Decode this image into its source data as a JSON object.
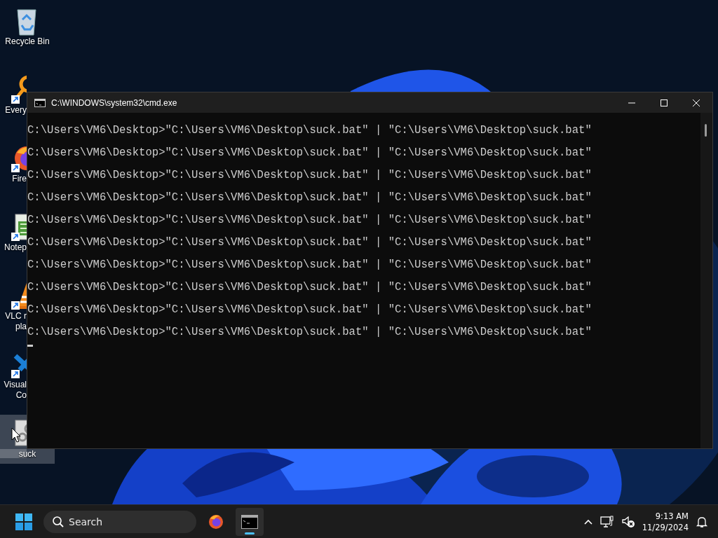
{
  "desktop_icons": [
    {
      "kind": "recycle",
      "lines": [
        "Recycle Bin"
      ],
      "shortcut": false,
      "selected": false
    },
    {
      "kind": "magnifier",
      "lines": [
        "Every"
      ],
      "shortcut": true,
      "selected": false
    },
    {
      "kind": "browser",
      "lines": [
        "Fire"
      ],
      "shortcut": true,
      "selected": false
    },
    {
      "kind": "notepad",
      "lines": [
        "Notep"
      ],
      "shortcut": true,
      "selected": false
    },
    {
      "kind": "cone",
      "lines": [
        "VLC r",
        "pla"
      ],
      "shortcut": true,
      "selected": false
    },
    {
      "kind": "ribbon",
      "lines": [
        "Visual",
        "Co"
      ],
      "shortcut": true,
      "selected": false
    },
    {
      "kind": "batch",
      "lines": [
        "suck"
      ],
      "shortcut": false,
      "selected": true
    }
  ],
  "window": {
    "title": "C:\\WINDOWS\\system32\\cmd.exe",
    "lines": [
      "C:\\Users\\VM6\\Desktop>\"C:\\Users\\VM6\\Desktop\\suck.bat\" | \"C:\\Users\\VM6\\Desktop\\suck.bat\"",
      "C:\\Users\\VM6\\Desktop>\"C:\\Users\\VM6\\Desktop\\suck.bat\" | \"C:\\Users\\VM6\\Desktop\\suck.bat\"",
      "C:\\Users\\VM6\\Desktop>\"C:\\Users\\VM6\\Desktop\\suck.bat\" | \"C:\\Users\\VM6\\Desktop\\suck.bat\"",
      "C:\\Users\\VM6\\Desktop>\"C:\\Users\\VM6\\Desktop\\suck.bat\" | \"C:\\Users\\VM6\\Desktop\\suck.bat\"",
      "C:\\Users\\VM6\\Desktop>\"C:\\Users\\VM6\\Desktop\\suck.bat\" | \"C:\\Users\\VM6\\Desktop\\suck.bat\"",
      "C:\\Users\\VM6\\Desktop>\"C:\\Users\\VM6\\Desktop\\suck.bat\" | \"C:\\Users\\VM6\\Desktop\\suck.bat\"",
      "C:\\Users\\VM6\\Desktop>\"C:\\Users\\VM6\\Desktop\\suck.bat\" | \"C:\\Users\\VM6\\Desktop\\suck.bat\"",
      "C:\\Users\\VM6\\Desktop>\"C:\\Users\\VM6\\Desktop\\suck.bat\" | \"C:\\Users\\VM6\\Desktop\\suck.bat\"",
      "C:\\Users\\VM6\\Desktop>\"C:\\Users\\VM6\\Desktop\\suck.bat\" | \"C:\\Users\\VM6\\Desktop\\suck.bat\"",
      "C:\\Users\\VM6\\Desktop>\"C:\\Users\\VM6\\Desktop\\suck.bat\" | \"C:\\Users\\VM6\\Desktop\\suck.bat\""
    ]
  },
  "taskbar": {
    "search": {
      "placeholder": "Search"
    },
    "apps": [
      {
        "kind": "browser",
        "selected": false
      },
      {
        "kind": "terminal",
        "selected": true
      }
    ],
    "time": "9:13 AM",
    "date": "11/29/2024"
  }
}
